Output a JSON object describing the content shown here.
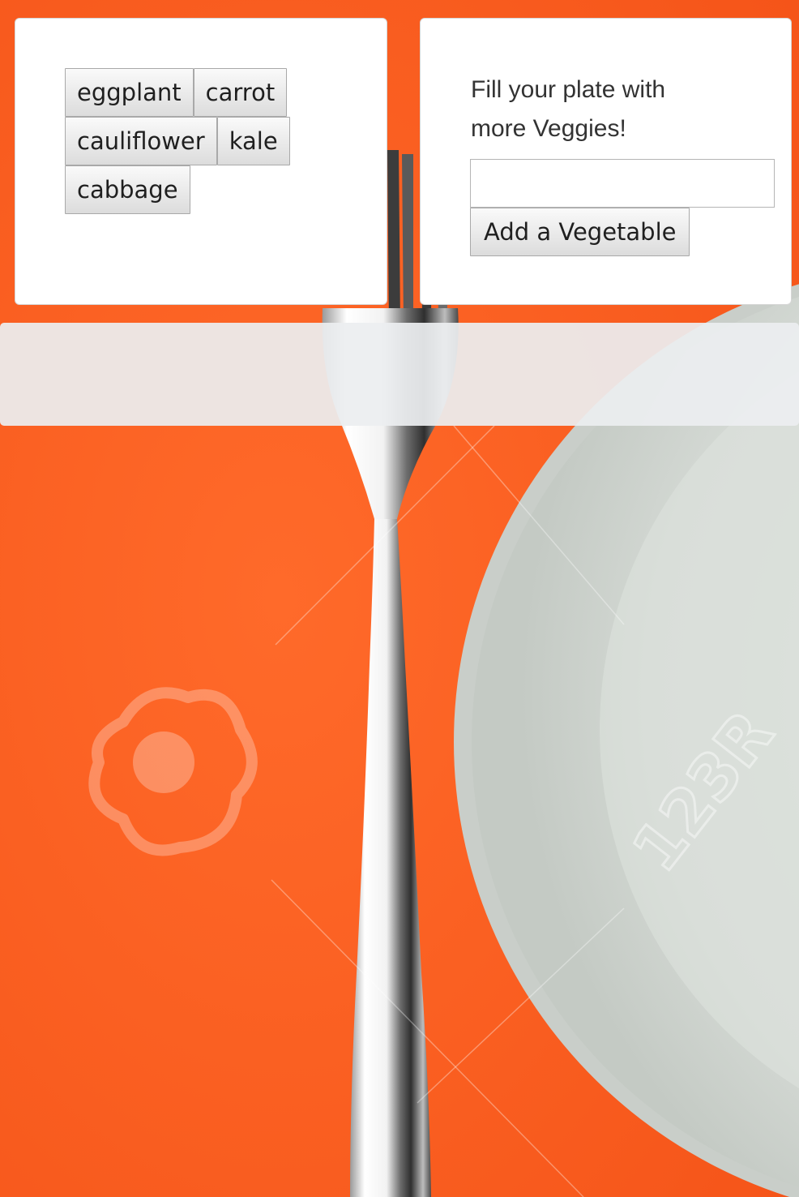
{
  "background": {
    "description_icon": "fork-and-plate-photo",
    "tablecloth_color": "#fb5f1f",
    "plate_color": "#d9ddd9",
    "watermark_text": "123R"
  },
  "vegetables": {
    "items": [
      "eggplant",
      "carrot",
      "cauliflower",
      "kale",
      "cabbage"
    ]
  },
  "add_form": {
    "prompt": "Fill your plate with more Veggies!",
    "input_value": "",
    "input_placeholder": "",
    "button_label": "Add a Vegetable"
  },
  "result_bar": {
    "text": ""
  }
}
